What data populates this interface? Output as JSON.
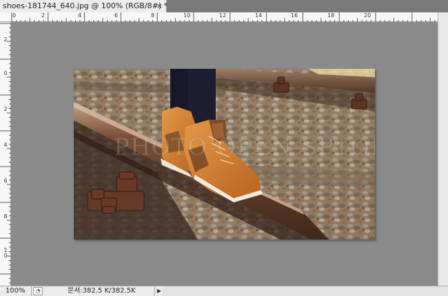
{
  "document_tab": {
    "title": "shoes-181744_640.jpg @ 100% (RGB/8#) *",
    "close_glyph": "×"
  },
  "ruler_top": {
    "labels": [
      "0",
      "2",
      "4",
      "6",
      "8",
      "10",
      "12",
      "14",
      "16",
      "18",
      "20"
    ]
  },
  "ruler_left": {
    "labels": [
      "2",
      "0",
      "2",
      "4",
      "6",
      "8",
      "10"
    ]
  },
  "image": {
    "watermark": "PHOTO-OPEN-SPTOR"
  },
  "statusbar": {
    "zoom": "100%",
    "doc_info": "문서:382.5 K/382.5K",
    "arrow_glyph": "▶"
  },
  "colors": {
    "canvas_bg": "#8b8b8b",
    "shoe_orange": "#d5802f",
    "rail_brown": "#5a3a22"
  }
}
